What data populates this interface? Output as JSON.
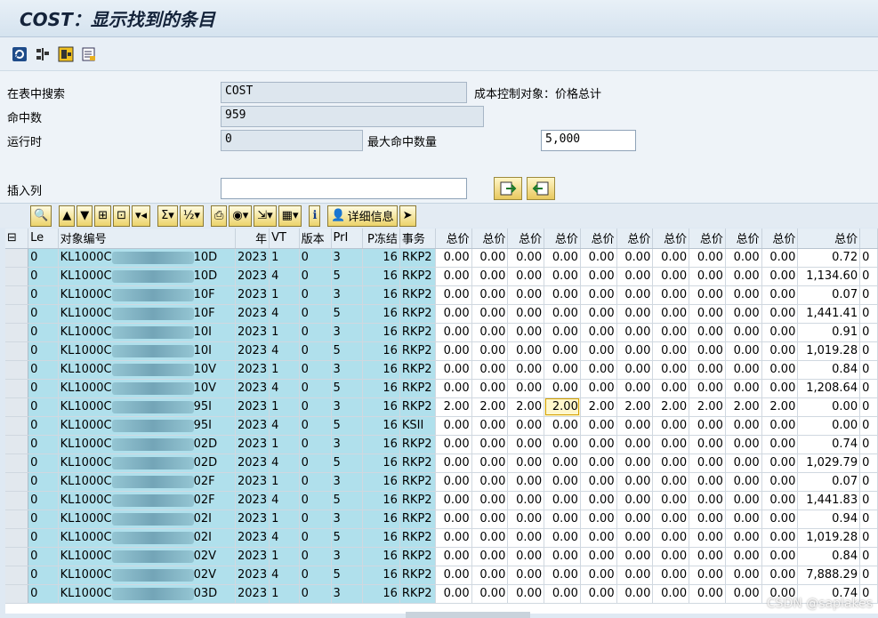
{
  "title": "COST：显示找到的条目",
  "toolbar": {
    "icons": [
      "refresh-icon",
      "settings-icon",
      "export-icon",
      "list-icon"
    ]
  },
  "form": {
    "search_label": "在表中搜索",
    "search_value": "COST",
    "search_desc": "成本控制对象：价格总计",
    "hits_label": "命中数",
    "hits_value": "959",
    "runtime_label": "运行时",
    "runtime_value": "0",
    "maxhits_label": "最大命中数量",
    "maxhits_value": "5,000",
    "insert_label": "插入列",
    "insert_value": ""
  },
  "alv": {
    "detail_label": "详细信息"
  },
  "table": {
    "headers": [
      "Le",
      "对象编号",
      "年",
      "VT",
      "版本",
      "PrI",
      "P冻结",
      "事务",
      "总价",
      "总价",
      "总价",
      "总价",
      "总价",
      "总价",
      "总价",
      "总价",
      "总价",
      "总价",
      "总价"
    ],
    "rows": [
      [
        "0",
        "KL1000C",
        "10D",
        "2023",
        "1",
        "0",
        "3",
        "16",
        "RKP2",
        "0.00",
        "0.00",
        "0.00",
        "0.00",
        "0.00",
        "0.00",
        "0.00",
        "0.00",
        "0.00",
        "0.00",
        "0.72"
      ],
      [
        "0",
        "KL1000C",
        "10D",
        "2023",
        "4",
        "0",
        "5",
        "16",
        "RKP2",
        "0.00",
        "0.00",
        "0.00",
        "0.00",
        "0.00",
        "0.00",
        "0.00",
        "0.00",
        "0.00",
        "0.00",
        "1,134.60"
      ],
      [
        "0",
        "KL1000C",
        "10F",
        "2023",
        "1",
        "0",
        "3",
        "16",
        "RKP2",
        "0.00",
        "0.00",
        "0.00",
        "0.00",
        "0.00",
        "0.00",
        "0.00",
        "0.00",
        "0.00",
        "0.00",
        "0.07"
      ],
      [
        "0",
        "KL1000C",
        "10F",
        "2023",
        "4",
        "0",
        "5",
        "16",
        "RKP2",
        "0.00",
        "0.00",
        "0.00",
        "0.00",
        "0.00",
        "0.00",
        "0.00",
        "0.00",
        "0.00",
        "0.00",
        "1,441.41"
      ],
      [
        "0",
        "KL1000C",
        "10I",
        "2023",
        "1",
        "0",
        "3",
        "16",
        "RKP2",
        "0.00",
        "0.00",
        "0.00",
        "0.00",
        "0.00",
        "0.00",
        "0.00",
        "0.00",
        "0.00",
        "0.00",
        "0.91"
      ],
      [
        "0",
        "KL1000C",
        "10I",
        "2023",
        "4",
        "0",
        "5",
        "16",
        "RKP2",
        "0.00",
        "0.00",
        "0.00",
        "0.00",
        "0.00",
        "0.00",
        "0.00",
        "0.00",
        "0.00",
        "0.00",
        "1,019.28"
      ],
      [
        "0",
        "KL1000C",
        "10V",
        "2023",
        "1",
        "0",
        "3",
        "16",
        "RKP2",
        "0.00",
        "0.00",
        "0.00",
        "0.00",
        "0.00",
        "0.00",
        "0.00",
        "0.00",
        "0.00",
        "0.00",
        "0.84"
      ],
      [
        "0",
        "KL1000C",
        "10V",
        "2023",
        "4",
        "0",
        "5",
        "16",
        "RKP2",
        "0.00",
        "0.00",
        "0.00",
        "0.00",
        "0.00",
        "0.00",
        "0.00",
        "0.00",
        "0.00",
        "0.00",
        "1,208.64"
      ],
      [
        "0",
        "KL1000C",
        "95I",
        "2023",
        "1",
        "0",
        "3",
        "16",
        "RKP2",
        "2.00",
        "2.00",
        "2.00",
        "2.00",
        "2.00",
        "2.00",
        "2.00",
        "2.00",
        "2.00",
        "2.00",
        "0.00"
      ],
      [
        "0",
        "KL1000C",
        "95I",
        "2023",
        "4",
        "0",
        "5",
        "16",
        "KSII",
        "0.00",
        "0.00",
        "0.00",
        "0.00",
        "0.00",
        "0.00",
        "0.00",
        "0.00",
        "0.00",
        "0.00",
        "0.00"
      ],
      [
        "0",
        "KL1000C",
        "02D",
        "2023",
        "1",
        "0",
        "3",
        "16",
        "RKP2",
        "0.00",
        "0.00",
        "0.00",
        "0.00",
        "0.00",
        "0.00",
        "0.00",
        "0.00",
        "0.00",
        "0.00",
        "0.74"
      ],
      [
        "0",
        "KL1000C",
        "02D",
        "2023",
        "4",
        "0",
        "5",
        "16",
        "RKP2",
        "0.00",
        "0.00",
        "0.00",
        "0.00",
        "0.00",
        "0.00",
        "0.00",
        "0.00",
        "0.00",
        "0.00",
        "1,029.79"
      ],
      [
        "0",
        "KL1000C",
        "02F",
        "2023",
        "1",
        "0",
        "3",
        "16",
        "RKP2",
        "0.00",
        "0.00",
        "0.00",
        "0.00",
        "0.00",
        "0.00",
        "0.00",
        "0.00",
        "0.00",
        "0.00",
        "0.07"
      ],
      [
        "0",
        "KL1000C",
        "02F",
        "2023",
        "4",
        "0",
        "5",
        "16",
        "RKP2",
        "0.00",
        "0.00",
        "0.00",
        "0.00",
        "0.00",
        "0.00",
        "0.00",
        "0.00",
        "0.00",
        "0.00",
        "1,441.83"
      ],
      [
        "0",
        "KL1000C",
        "02I",
        "2023",
        "1",
        "0",
        "3",
        "16",
        "RKP2",
        "0.00",
        "0.00",
        "0.00",
        "0.00",
        "0.00",
        "0.00",
        "0.00",
        "0.00",
        "0.00",
        "0.00",
        "0.94"
      ],
      [
        "0",
        "KL1000C",
        "02I",
        "2023",
        "4",
        "0",
        "5",
        "16",
        "RKP2",
        "0.00",
        "0.00",
        "0.00",
        "0.00",
        "0.00",
        "0.00",
        "0.00",
        "0.00",
        "0.00",
        "0.00",
        "1,019.28"
      ],
      [
        "0",
        "KL1000C",
        "02V",
        "2023",
        "1",
        "0",
        "3",
        "16",
        "RKP2",
        "0.00",
        "0.00",
        "0.00",
        "0.00",
        "0.00",
        "0.00",
        "0.00",
        "0.00",
        "0.00",
        "0.00",
        "0.84"
      ],
      [
        "0",
        "KL1000C",
        "02V",
        "2023",
        "4",
        "0",
        "5",
        "16",
        "RKP2",
        "0.00",
        "0.00",
        "0.00",
        "0.00",
        "0.00",
        "0.00",
        "0.00",
        "0.00",
        "0.00",
        "0.00",
        "7,888.29"
      ],
      [
        "0",
        "KL1000C",
        "03D",
        "2023",
        "1",
        "0",
        "3",
        "16",
        "RKP2",
        "0.00",
        "0.00",
        "0.00",
        "0.00",
        "0.00",
        "0.00",
        "0.00",
        "0.00",
        "0.00",
        "0.00",
        "0.74"
      ]
    ],
    "highlight": {
      "row": 8,
      "col": 12
    }
  },
  "watermark": "CSDN @saplakes",
  "colors": {
    "key_bg": "#b0e0ec",
    "title": "#14233a"
  }
}
